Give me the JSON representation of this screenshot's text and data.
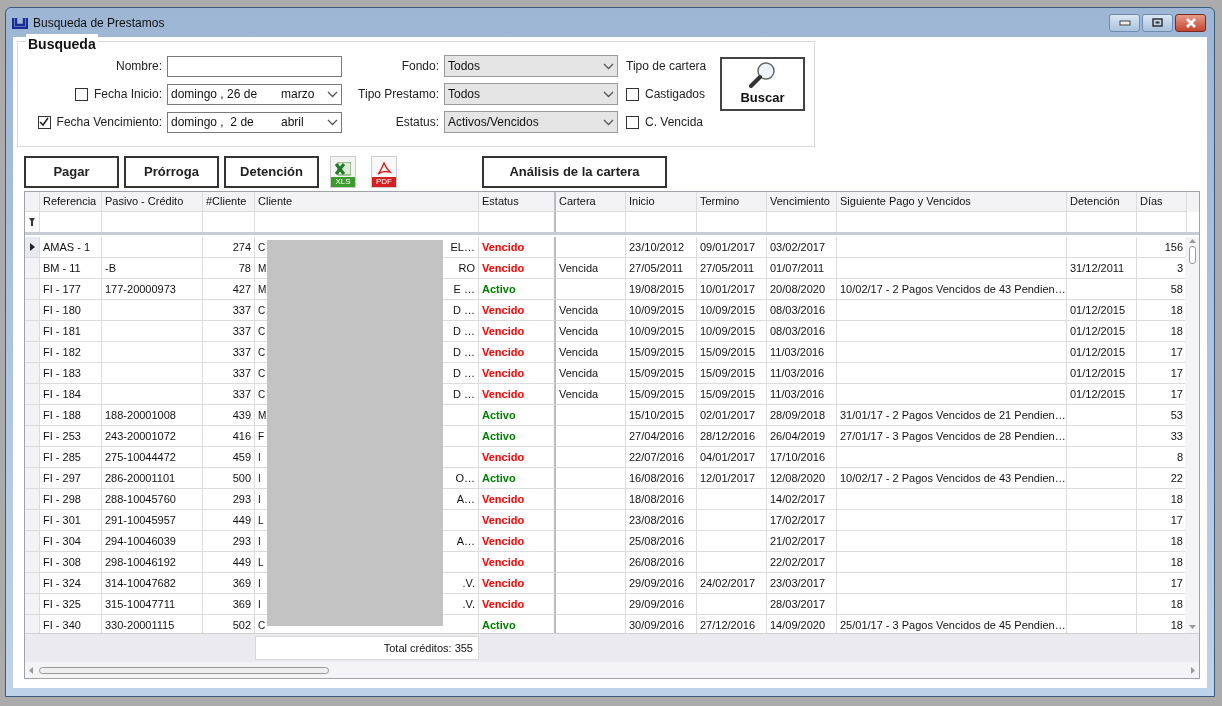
{
  "window": {
    "title": "Busqueda de Prestamos"
  },
  "search": {
    "legend": "Busqueda",
    "nombre": {
      "label": "Nombre:"
    },
    "fecha_inicio": {
      "label": "Fecha Inicio:",
      "checked": false,
      "day": "domingo , 26 de",
      "month": "marzo"
    },
    "fecha_vencimiento": {
      "label": "Fecha Vencimiento:",
      "checked": true,
      "day": "domingo ,  2 de",
      "month": "abril"
    },
    "dropdowns": [
      {
        "label": "Fondo:",
        "value": "Todos"
      },
      {
        "label": "Tipo Prestamo:",
        "value": "Todos"
      },
      {
        "label": "Estatus:",
        "value": "Activos/Vencidos"
      }
    ],
    "tipo_cartera": {
      "label": "Tipo de cartera",
      "options": [
        {
          "label": "Castigados",
          "checked": false
        },
        {
          "label": "C. Vencida",
          "checked": false
        }
      ]
    },
    "buscar": "Buscar"
  },
  "actions": [
    {
      "kind": "button",
      "label": "Pagar"
    },
    {
      "kind": "button",
      "label": "Prórroga"
    },
    {
      "kind": "button",
      "label": "Detención"
    },
    {
      "kind": "xls",
      "label": "XLS"
    },
    {
      "kind": "pdf",
      "label": "PDF"
    },
    {
      "kind": "wide",
      "label": "Análisis de la cartera"
    }
  ],
  "table": {
    "columns": [
      "Referencia",
      "Pasivo - Crédito",
      "#Cliente",
      "Cliente",
      "Estatus",
      "Cartera",
      "Inicio",
      "Termino",
      "Vencimiento",
      "Siguiente Pago y Vencidos",
      "Detención",
      "Días"
    ],
    "rows": [
      {
        "selected": true,
        "ref": "AMAS - 1",
        "num": "274",
        "c1": "C",
        "c2": "EL…",
        "estatus": "Vencido",
        "color": "#ff0000",
        "inicio": "23/10/2012",
        "termino": "09/01/2017",
        "venc": "03/02/2017",
        "dias": "156"
      },
      {
        "selected": false,
        "ref": "BM - 11",
        "pasivo": "-B",
        "num": "78",
        "c1": "M",
        "c2": "RO",
        "estatus": "Vencido",
        "color": "#ff0000",
        "cartera": "Vencida",
        "inicio": "27/05/2011",
        "termino": "27/05/2011",
        "venc": "01/07/2011",
        "det": "31/12/2011",
        "dias": "3"
      },
      {
        "selected": false,
        "ref": "FI - 177",
        "pasivo": "177-20000973",
        "num": "427",
        "c1": "M",
        "c2": "E …",
        "estatus": "Activo",
        "color": "#008000",
        "inicio": "19/08/2015",
        "termino": "10/01/2017",
        "venc": "20/08/2020",
        "sig": "10/02/17 - 2 Pagos Vencidos de 43 Pendien…",
        "dias": "58"
      },
      {
        "selected": false,
        "ref": "FI - 180",
        "num": "337",
        "c1": "C",
        "c2": "D …",
        "estatus": "Vencido",
        "color": "#ff0000",
        "cartera": "Vencida",
        "inicio": "10/09/2015",
        "termino": "10/09/2015",
        "venc": "08/03/2016",
        "det": "01/12/2015",
        "dias": "18"
      },
      {
        "selected": false,
        "ref": "FI - 181",
        "num": "337",
        "c1": "C",
        "c2": "D …",
        "estatus": "Vencido",
        "color": "#ff0000",
        "cartera": "Vencida",
        "inicio": "10/09/2015",
        "termino": "10/09/2015",
        "venc": "08/03/2016",
        "det": "01/12/2015",
        "dias": "18"
      },
      {
        "selected": false,
        "ref": "FI - 182",
        "num": "337",
        "c1": "C",
        "c2": "D …",
        "estatus": "Vencido",
        "color": "#ff0000",
        "cartera": "Vencida",
        "inicio": "15/09/2015",
        "termino": "15/09/2015",
        "venc": "11/03/2016",
        "det": "01/12/2015",
        "dias": "17"
      },
      {
        "selected": false,
        "ref": "FI - 183",
        "num": "337",
        "c1": "C",
        "c2": "D …",
        "estatus": "Vencido",
        "color": "#ff0000",
        "cartera": "Vencida",
        "inicio": "15/09/2015",
        "termino": "15/09/2015",
        "venc": "11/03/2016",
        "det": "01/12/2015",
        "dias": "17"
      },
      {
        "selected": false,
        "ref": "FI - 184",
        "num": "337",
        "c1": "C",
        "c2": "D …",
        "estatus": "Vencido",
        "color": "#ff0000",
        "cartera": "Vencida",
        "inicio": "15/09/2015",
        "termino": "15/09/2015",
        "venc": "11/03/2016",
        "det": "01/12/2015",
        "dias": "17"
      },
      {
        "selected": false,
        "ref": "FI - 188",
        "pasivo": "188-20001008",
        "num": "439",
        "c1": "M",
        "estatus": "Activo",
        "color": "#008000",
        "inicio": "15/10/2015",
        "termino": "02/01/2017",
        "venc": "28/09/2018",
        "sig": "31/01/17 - 2 Pagos Vencidos de 21 Pendien…",
        "dias": "53"
      },
      {
        "selected": false,
        "ref": "FI - 253",
        "pasivo": "243-20001072",
        "num": "416",
        "c1": "F",
        "estatus": "Activo",
        "color": "#008000",
        "inicio": "27/04/2016",
        "termino": "28/12/2016",
        "venc": "26/04/2019",
        "sig": "27/01/17 - 3 Pagos Vencidos de 28 Pendien…",
        "dias": "33"
      },
      {
        "selected": false,
        "ref": "FI - 285",
        "pasivo": "275-10044472",
        "num": "459",
        "c1": "I",
        "estatus": "Vencido",
        "color": "#ff0000",
        "inicio": "22/07/2016",
        "termino": "04/01/2017",
        "venc": "17/10/2016",
        "dias": "8"
      },
      {
        "selected": false,
        "ref": "FI - 297",
        "pasivo": "286-20001101",
        "num": "500",
        "c1": "I",
        "c2": "O…",
        "estatus": "Activo",
        "color": "#008000",
        "inicio": "16/08/2016",
        "termino": "12/01/2017",
        "venc": "12/08/2020",
        "sig": "10/02/17 - 2 Pagos Vencidos de 43 Pendien…",
        "dias": "22"
      },
      {
        "selected": false,
        "ref": "FI - 298",
        "pasivo": "288-10045760",
        "num": "293",
        "c1": "I",
        "c2": "A…",
        "estatus": "Vencido",
        "color": "#ff0000",
        "inicio": "18/08/2016",
        "venc": "14/02/2017",
        "dias": "18"
      },
      {
        "selected": false,
        "ref": "FI - 301",
        "pasivo": "291-10045957",
        "num": "449",
        "c1": "L",
        "estatus": "Vencido",
        "color": "#ff0000",
        "inicio": "23/08/2016",
        "venc": "17/02/2017",
        "dias": "17"
      },
      {
        "selected": false,
        "ref": "FI - 304",
        "pasivo": "294-10046039",
        "num": "293",
        "c1": "I",
        "c2": "A…",
        "estatus": "Vencido",
        "color": "#ff0000",
        "inicio": "25/08/2016",
        "venc": "21/02/2017",
        "dias": "18"
      },
      {
        "selected": false,
        "ref": "FI - 308",
        "pasivo": "298-10046192",
        "num": "449",
        "c1": "L",
        "estatus": "Vencido",
        "color": "#ff0000",
        "inicio": "26/08/2016",
        "venc": "22/02/2017",
        "dias": "18"
      },
      {
        "selected": false,
        "ref": "FI - 324",
        "pasivo": "314-10047682",
        "num": "369",
        "c1": "I",
        "c2": ".V.",
        "estatus": "Vencido",
        "color": "#ff0000",
        "inicio": "29/09/2016",
        "termino": "24/02/2017",
        "venc": "23/03/2017",
        "dias": "17"
      },
      {
        "selected": false,
        "ref": "FI - 325",
        "pasivo": "315-10047711",
        "num": "369",
        "c1": "I",
        "c2": ".V.",
        "estatus": "Vencido",
        "color": "#ff0000",
        "inicio": "29/09/2016",
        "venc": "28/03/2017",
        "dias": "18"
      },
      {
        "selected": false,
        "ref": "FI - 340",
        "pasivo": "330-20001115",
        "num": "502",
        "c1": "C",
        "estatus": "Activo",
        "color": "#008000",
        "inicio": "30/09/2016",
        "termino": "27/12/2016",
        "venc": "14/09/2020",
        "sig": "25/01/17 - 3 Pagos Vencidos de 45 Pendien…",
        "dias": "18"
      }
    ],
    "total": "Total créditos: 355"
  }
}
